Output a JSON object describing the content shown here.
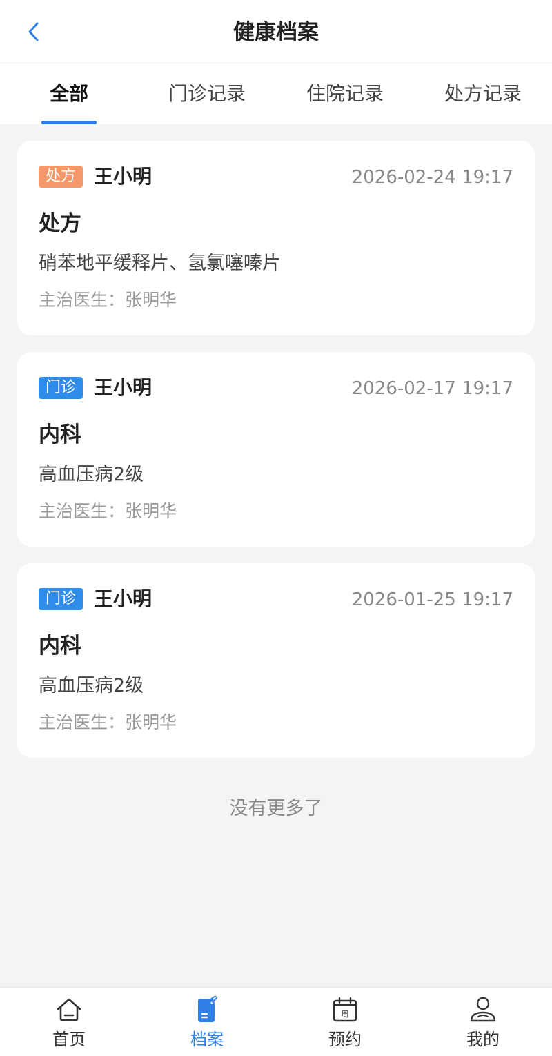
{
  "header": {
    "title": "健康档案"
  },
  "tabs": [
    {
      "label": "全部",
      "active": true
    },
    {
      "label": "门诊记录",
      "active": false
    },
    {
      "label": "住院记录",
      "active": false
    },
    {
      "label": "处方记录",
      "active": false
    }
  ],
  "colors": {
    "accent": "#2f7fe6",
    "tag_prescription": "#f59869",
    "tag_outpatient": "#2f8ce8"
  },
  "records": [
    {
      "tag": "处方",
      "tag_color": "#f59869",
      "patient": "王小明",
      "time": "2026-02-24 19:17",
      "title": "处方",
      "detail": "硝苯地平缓释片、氢氯噻嗪片",
      "doctor_label": "主治医生：",
      "doctor": "张明华"
    },
    {
      "tag": "门诊",
      "tag_color": "#2f8ce8",
      "patient": "王小明",
      "time": "2026-02-17 19:17",
      "title": "内科",
      "detail": "高血压病2级",
      "doctor_label": "主治医生：",
      "doctor": "张明华"
    },
    {
      "tag": "门诊",
      "tag_color": "#2f8ce8",
      "patient": "王小明",
      "time": "2026-01-25 19:17",
      "title": "内科",
      "detail": "高血压病2级",
      "doctor_label": "主治医生：",
      "doctor": "张明华"
    }
  ],
  "footer_text": "没有更多了",
  "tabbar": [
    {
      "label": "首页",
      "icon": "home-icon",
      "active": false
    },
    {
      "label": "档案",
      "icon": "archive-icon",
      "active": true
    },
    {
      "label": "预约",
      "icon": "calendar-icon",
      "active": false,
      "icon_text": "周"
    },
    {
      "label": "我的",
      "icon": "profile-icon",
      "active": false
    }
  ]
}
